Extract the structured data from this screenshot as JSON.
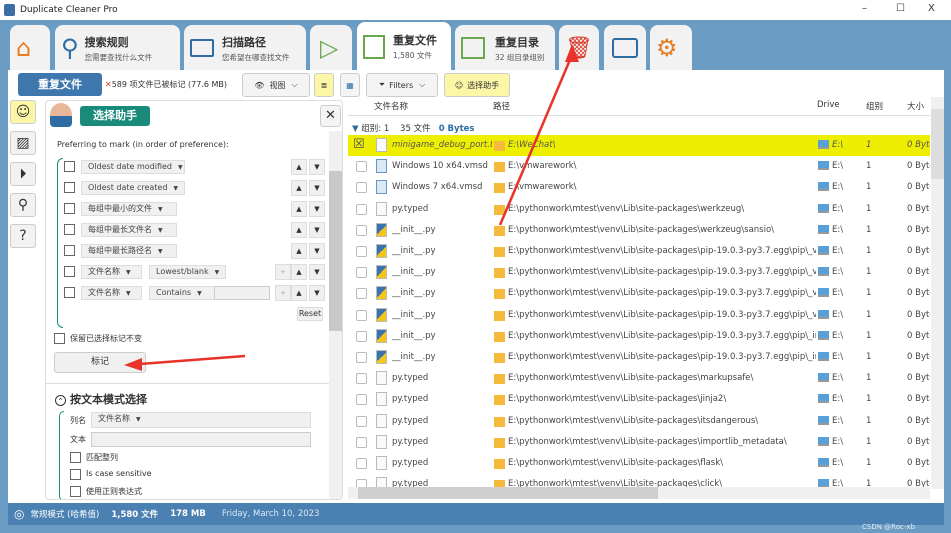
{
  "window": {
    "title": "Duplicate Cleaner Pro",
    "min": "–",
    "max": "☐",
    "close": "X"
  },
  "tabs": [
    {
      "label": "",
      "icon": "home-icon"
    },
    {
      "label": "搜索规则",
      "sub": "您需要查找什么文件",
      "icon": "search-icon"
    },
    {
      "label": "扫描路径",
      "sub": "您希望在哪查找文件",
      "icon": "folder-icon"
    },
    {
      "label": "",
      "icon": "play-icon"
    },
    {
      "label": "重复文件",
      "sub": "1,580 文件",
      "icon": "duplicate-files-icon"
    },
    {
      "label": "重复目录",
      "sub": "32 组目录组别",
      "icon": "duplicate-folders-icon"
    },
    {
      "label": "",
      "icon": "trash-move-icon"
    },
    {
      "label": "",
      "icon": "toolbox-icon"
    },
    {
      "label": "",
      "icon": "gears-icon"
    }
  ],
  "toolbar": {
    "title": "重复文件",
    "marked": "589 项文件已被标记 (77.6 MB)",
    "view": "视图",
    "filters": "Filters",
    "assistant": "选择助手"
  },
  "panel": {
    "title": "选择助手",
    "prefer": "Preferring to mark (in order of preference):",
    "rules": [
      {
        "a": "Oldest date modified"
      },
      {
        "a": "Oldest date created"
      },
      {
        "a": "每组中最小的文件"
      },
      {
        "a": "每组中最长文件名"
      },
      {
        "a": "每组中最长路径名"
      },
      {
        "a": "文件名称",
        "b": "Lowest/blank"
      },
      {
        "a": "文件名称",
        "b": "Contains"
      }
    ],
    "reset": "Reset",
    "keep": "保留已选择标记不变",
    "mark": "标记",
    "text_section": "按文本模式选择",
    "col_label": "列名",
    "col_value": "文件名称",
    "text_label": "文本",
    "text_value": "",
    "opt1": "匹配整列",
    "opt2": "Is case sensitive",
    "opt3": "使用正则表达式"
  },
  "table": {
    "headers": [
      "文件名称",
      "路径",
      "Drive",
      "组别",
      "大小"
    ],
    "group": {
      "label": "组别: 1",
      "count": "35 文件",
      "size": "0 Bytes"
    },
    "rows": [
      {
        "name": "minigame_debug_port.txt",
        "path": "E:\\WeChat\\",
        "drive": "E:\\",
        "grp": "1",
        "size": "0 Bytes",
        "icon": "txt",
        "marked": true
      },
      {
        "name": "Windows 10 x64.vmsd",
        "path": "E:\\vmwarework\\",
        "drive": "E:\\",
        "grp": "1",
        "size": "0 Bytes",
        "icon": "vm"
      },
      {
        "name": "Windows 7 x64.vmsd",
        "path": "E:\\vmwarework\\",
        "drive": "E:\\",
        "grp": "1",
        "size": "0 Bytes",
        "icon": "vm"
      },
      {
        "name": "py.typed",
        "path": "E:\\pythonwork\\mtest\\venv\\Lib\\site-packages\\werkzeug\\",
        "drive": "E:\\",
        "grp": "1",
        "size": "0 Bytes",
        "icon": "txt"
      },
      {
        "name": "__init__.py",
        "path": "E:\\pythonwork\\mtest\\venv\\Lib\\site-packages\\werkzeug\\sansio\\",
        "drive": "E:\\",
        "grp": "1",
        "size": "0 Bytes",
        "icon": "py"
      },
      {
        "name": "__init__.py",
        "path": "E:\\pythonwork\\mtest\\venv\\Lib\\site-packages\\pip-19.0.3-py3.7.egg\\pip\\_ven",
        "drive": "E:\\",
        "grp": "1",
        "size": "0 Bytes",
        "icon": "py"
      },
      {
        "name": "__init__.py",
        "path": "E:\\pythonwork\\mtest\\venv\\Lib\\site-packages\\pip-19.0.3-py3.7.egg\\pip\\_ven",
        "drive": "E:\\",
        "grp": "1",
        "size": "0 Bytes",
        "icon": "py"
      },
      {
        "name": "__init__.py",
        "path": "E:\\pythonwork\\mtest\\venv\\Lib\\site-packages\\pip-19.0.3-py3.7.egg\\pip\\_ven",
        "drive": "E:\\",
        "grp": "1",
        "size": "0 Bytes",
        "icon": "py"
      },
      {
        "name": "__init__.py",
        "path": "E:\\pythonwork\\mtest\\venv\\Lib\\site-packages\\pip-19.0.3-py3.7.egg\\pip\\_ven",
        "drive": "E:\\",
        "grp": "1",
        "size": "0 Bytes",
        "icon": "py"
      },
      {
        "name": "__init__.py",
        "path": "E:\\pythonwork\\mtest\\venv\\Lib\\site-packages\\pip-19.0.3-py3.7.egg\\pip\\_inte",
        "drive": "E:\\",
        "grp": "1",
        "size": "0 Bytes",
        "icon": "py"
      },
      {
        "name": "__init__.py",
        "path": "E:\\pythonwork\\mtest\\venv\\Lib\\site-packages\\pip-19.0.3-py3.7.egg\\pip\\_inte",
        "drive": "E:\\",
        "grp": "1",
        "size": "0 Bytes",
        "icon": "py"
      },
      {
        "name": "py.typed",
        "path": "E:\\pythonwork\\mtest\\venv\\Lib\\site-packages\\markupsafe\\",
        "drive": "E:\\",
        "grp": "1",
        "size": "0 Bytes",
        "icon": "txt"
      },
      {
        "name": "py.typed",
        "path": "E:\\pythonwork\\mtest\\venv\\Lib\\site-packages\\jinja2\\",
        "drive": "E:\\",
        "grp": "1",
        "size": "0 Bytes",
        "icon": "txt"
      },
      {
        "name": "py.typed",
        "path": "E:\\pythonwork\\mtest\\venv\\Lib\\site-packages\\itsdangerous\\",
        "drive": "E:\\",
        "grp": "1",
        "size": "0 Bytes",
        "icon": "txt"
      },
      {
        "name": "py.typed",
        "path": "E:\\pythonwork\\mtest\\venv\\Lib\\site-packages\\importlib_metadata\\",
        "drive": "E:\\",
        "grp": "1",
        "size": "0 Bytes",
        "icon": "txt"
      },
      {
        "name": "py.typed",
        "path": "E:\\pythonwork\\mtest\\venv\\Lib\\site-packages\\flask\\",
        "drive": "E:\\",
        "grp": "1",
        "size": "0 Bytes",
        "icon": "txt"
      },
      {
        "name": "py.typed",
        "path": "E:\\pythonwork\\mtest\\venv\\Lib\\site-packages\\click\\",
        "drive": "E:\\",
        "grp": "1",
        "size": "0 Bytes",
        "icon": "txt"
      }
    ]
  },
  "status": {
    "mode": "常规模式 (哈希值)",
    "files": "1,580 文件",
    "size": "178 MB",
    "date": "Friday, March 10, 2023"
  },
  "watermark": "CSDN @Roc-xb",
  "colors": {
    "accent": "#2e6da4",
    "teal": "#1a8a7a",
    "marked_row": "#eeee00",
    "status": "#4a80b2"
  }
}
